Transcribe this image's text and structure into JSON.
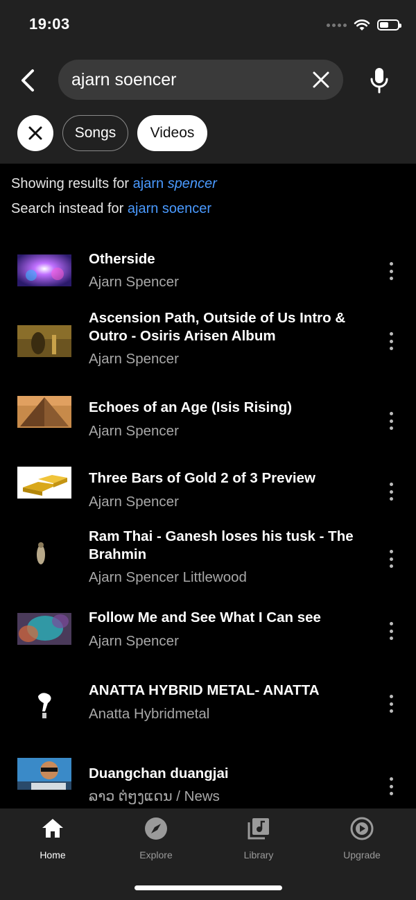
{
  "status": {
    "time": "19:03"
  },
  "search": {
    "query": "ajarn soencer"
  },
  "chips": [
    {
      "label": "Songs",
      "selected": false
    },
    {
      "label": "Videos",
      "selected": true
    }
  ],
  "suggestion": {
    "showing_prefix": "Showing results for",
    "corrected_plain": "ajarn",
    "corrected_emphasis": "spencer",
    "instead_prefix": "Search instead for",
    "original_query": "ajarn soencer"
  },
  "results": [
    {
      "title": "Otherside",
      "artist": "Ajarn Spencer"
    },
    {
      "title": "Ascension Path, Outside of Us Intro & Outro - Osiris Arisen Album",
      "artist": "Ajarn Spencer"
    },
    {
      "title": "Echoes of an Age (Isis Rising)",
      "artist": "Ajarn Spencer"
    },
    {
      "title": "Three Bars of Gold 2 of 3 Preview",
      "artist": "Ajarn Spencer"
    },
    {
      "title": "Ram Thai - Ganesh loses his tusk - The Brahmin",
      "artist": "Ajarn Spencer Littlewood"
    },
    {
      "title": "Follow Me and See What I Can see",
      "artist": "Ajarn Spencer"
    },
    {
      "title": "ANATTA HYBRID METAL- ANATTA",
      "artist": "Anatta Hybridmetal"
    },
    {
      "title": "Duangchan duangjai",
      "artist": "ລາວ ຕ່ໆງແດນ / News"
    }
  ],
  "nav": {
    "home": "Home",
    "explore": "Explore",
    "library": "Library",
    "upgrade": "Upgrade"
  },
  "colors": {
    "accent_link": "#4a9aff",
    "background": "#000000",
    "header": "#212121"
  }
}
